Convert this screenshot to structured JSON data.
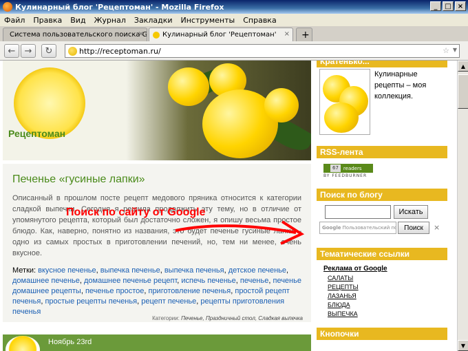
{
  "window": {
    "title": "Кулинарный блог 'Рецептоман' - Mozilla Firefox"
  },
  "menu": [
    "Файл",
    "Правка",
    "Вид",
    "Журнал",
    "Закладки",
    "Инструменты",
    "Справка"
  ],
  "tabs": [
    {
      "label": "Система пользовательского поиска Go..."
    },
    {
      "label": "Кулинарный блог 'Рецептоман'"
    }
  ],
  "navbar": {
    "url": "http://receptoman.ru/"
  },
  "header": {
    "site_name": "Рецептоман"
  },
  "post": {
    "title": "Печенье «гусиные лапки»",
    "text": "Описанный в прошлом посте рецепт медового пряника относится к категории сладкой выпечки. Сегодня я решила продолжить эту тему, но в отличие от упомянутого рецепта, который был достаточно сложен, я опишу весьма простое блюдо. Как, наверно, понятно из названия, это будет печенье гусиные лапки – одно из самых простых в приготовлении печений, но, тем ни менее, очень вкусное.",
    "tags_label": "Метки:",
    "tags": [
      "вкусное печенье",
      "выпечка печенье",
      "выпечка печенья",
      "детское печенье",
      "домашнее печенье",
      "домашнее печенье рецепт",
      "испечь печенье",
      "печенье",
      "печенье домашнее рецепты",
      "печенье простое",
      "приготовление печенья",
      "простой рецепт печенья",
      "простые рецепты печенья",
      "рецепт печенье",
      "рецепты приготовления печенья"
    ],
    "categories_label": "Категории:",
    "categories": "Печенье, Праздничный стол, Сладкая выпечка"
  },
  "overlay": {
    "text": "Поиск по сайту от Google"
  },
  "footer": {
    "date": "Ноябрь 23rd"
  },
  "sidebar": {
    "about_head": "Кратенько...",
    "about_text": "Кулинарные рецепты – моя коллекция.",
    "rss_head": "RSS-лента",
    "rss_count": "67",
    "rss_readers": "readers",
    "rss_by": "BY FEEDBURNER",
    "search_head": "Поиск по блогу",
    "search_button": "Искать",
    "gsearch_placeholder": "Пользовательский поиск",
    "gsearch_google": "Google",
    "gsearch_button": "Поиск",
    "links_head": "Тематические ссылки",
    "ad_link": "Реклама от Google",
    "links": [
      "САЛАТЫ",
      "РЕЦЕПТЫ",
      "ЛАЗАНЬЯ",
      "БЛЮДА",
      "ВЫПЕЧКА"
    ],
    "buttons_head": "Кнопочки"
  }
}
